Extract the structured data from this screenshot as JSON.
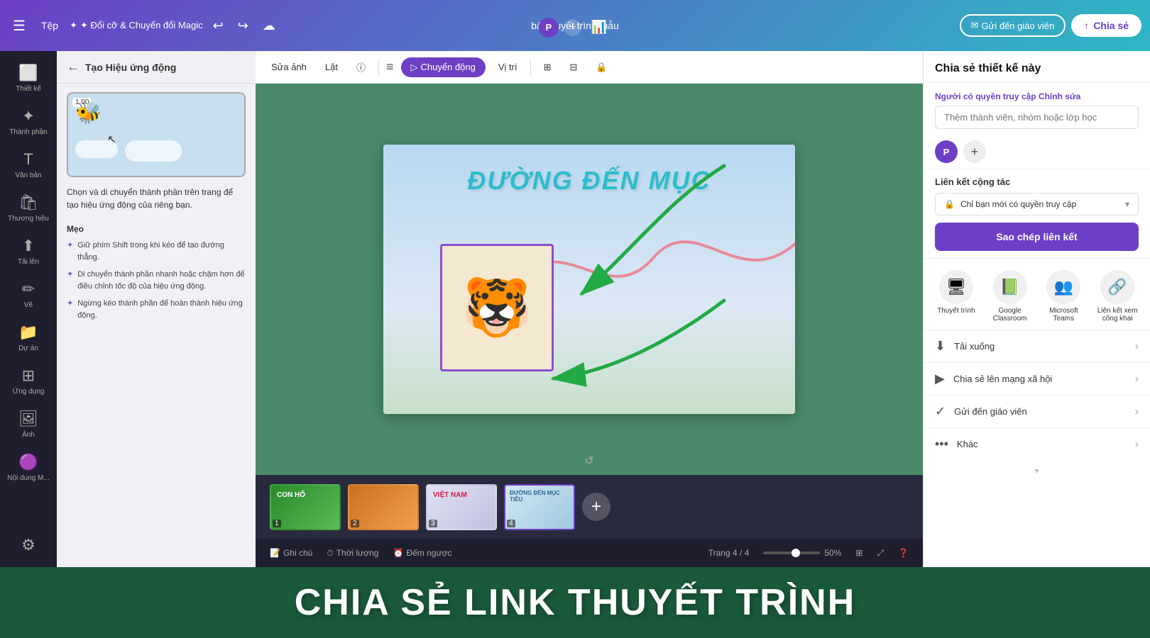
{
  "header": {
    "menu_label": "☰",
    "tep_label": "Tệp",
    "magic_label": "✦ Đổi cỡ & Chuyển đổi Magic",
    "undo_icon": "↩",
    "redo_icon": "↪",
    "cloud_icon": "☁",
    "title": "bài thuyết trình mẫu",
    "gui_label": "Gửi đến giáo viên",
    "chia_se_label": "Chia sẻ"
  },
  "sidebar": {
    "items": [
      {
        "icon": "⬜",
        "label": "Thiết kế"
      },
      {
        "icon": "✦",
        "label": "Thành phần"
      },
      {
        "icon": "T",
        "label": "Văn bản"
      },
      {
        "icon": "🛍",
        "label": "Thương hiệu"
      },
      {
        "icon": "⬆",
        "label": "Tải lên"
      },
      {
        "icon": "✏",
        "label": "Vẽ"
      },
      {
        "icon": "📁",
        "label": "Dự án"
      },
      {
        "icon": "⊞",
        "label": "Ứng dụng"
      },
      {
        "icon": "🖼",
        "label": "Ảnh"
      },
      {
        "icon": "🟣",
        "label": "Nội dung M..."
      }
    ]
  },
  "panel": {
    "back_label": "←",
    "title": "Tạo Hiệu ứng động",
    "badge": "1.00",
    "desc": "Chọn và di chuyển thành phần trên trang để tạo hiệu ứng động của riêng bạn.",
    "tips_title": "Mẹo",
    "tips": [
      "Giữ phím Shift trong khi kéo để tạo đường thẳng.",
      "Di chuyển thành phần nhanh hoặc chậm hơn để điều chỉnh tốc độ của hiệu ứng động.",
      "Ngừng kéo thành phần để hoàn thành hiệu ứng động."
    ]
  },
  "canvas": {
    "toolbar": {
      "sua_anh": "Sửa ảnh",
      "lat": "Lật",
      "chuyen_dong": "Chuyển động",
      "vi_tri": "Vị trí"
    },
    "slide": {
      "title": "ĐƯỜNG ĐẾN MỤC"
    },
    "footer": {
      "ghi_chu": "Ghi chú",
      "thoi_luong": "Thời lượng",
      "dem_nguoc": "Đếm ngược",
      "page_info": "Trang 4 / 4",
      "zoom": "50%"
    },
    "thumbnails": [
      {
        "num": "1",
        "label": "CON HỔ"
      },
      {
        "num": "2",
        "label": ""
      },
      {
        "num": "3",
        "label": "VIỆT NAM"
      },
      {
        "num": "4",
        "label": "ĐƯỜNG ĐẾN MỤC TIÊU",
        "active": true
      }
    ]
  },
  "share_panel": {
    "title": "Chia sẻ thiết kế này",
    "nguoi_co_quyen": "Người có quyền truy cập",
    "chinh_sua": "Chỉnh sửa",
    "input_placeholder": "Thêm thành viên, nhóm hoặc lớp học",
    "lien_ket_truy_cap": "Liên kết cộng tác",
    "chi_ban_moi": "Chỉ bạn mới có quyền truy cập",
    "copy_btn": "Sao chép liên kết",
    "icons": [
      {
        "icon": "🖥",
        "label": "Thuyết trình"
      },
      {
        "icon": "📗",
        "label": "Google Classroom"
      },
      {
        "icon": "👥",
        "label": "Microsoft Teams"
      },
      {
        "icon": "🔗",
        "label": "Liên kết xem công khai"
      }
    ],
    "menu_items": [
      {
        "icon": "⬇",
        "label": "Tải xuống"
      },
      {
        "icon": "▶",
        "label": "Chia sẻ lên mạng xã hội"
      },
      {
        "icon": "✓",
        "label": "Gửi đến giáo viên"
      },
      {
        "icon": "•••",
        "label": "Khác"
      }
    ]
  },
  "bottom_banner": {
    "text": "CHIA SẺ LINK THUYẾT TRÌNH"
  }
}
